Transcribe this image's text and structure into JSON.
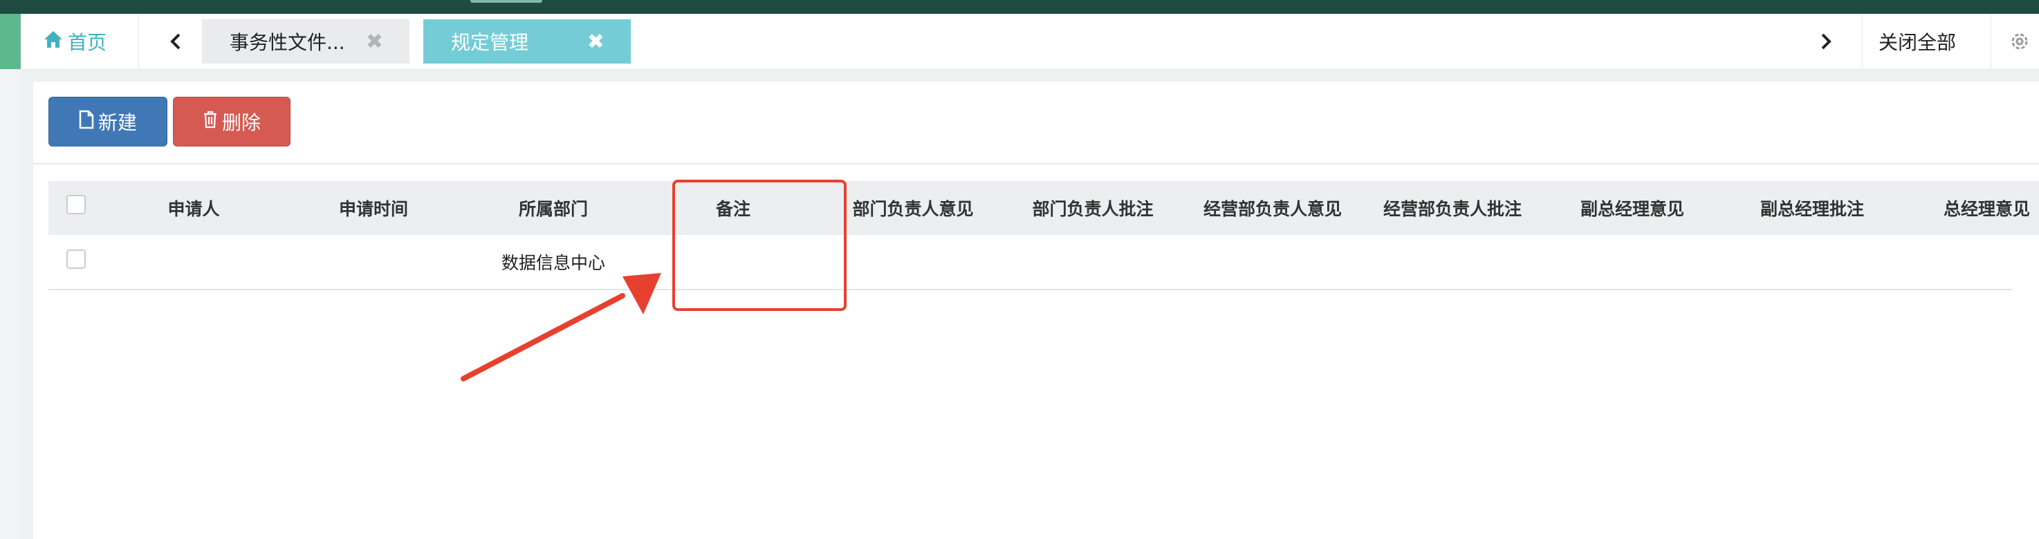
{
  "tabs": {
    "home_label": "首页",
    "tab1_label": "事务性文件...",
    "tab2_label": "规定管理",
    "close_glyph": "✖",
    "close_all_label": "关闭全部"
  },
  "toolbar": {
    "new_label": "新建",
    "delete_label": "删除"
  },
  "table": {
    "columns": [
      "申请人",
      "申请时间",
      "所属部门",
      "备注",
      "部门负责人意见",
      "部门负责人批注",
      "经营部负责人意见",
      "经营部负责人批注",
      "副总经理意见",
      "副总经理批注",
      "总经理意见"
    ],
    "rows": [
      {
        "applicant": "",
        "time": "",
        "department": "数据信息中心",
        "remark": ""
      }
    ]
  },
  "colors": {
    "accent": "#74ccd6",
    "primary": "#3f78b5",
    "danger": "#d55a52",
    "annotation": "#e7402f"
  },
  "icons": [
    "home-icon",
    "chevron-left-icon",
    "chevron-right-icon",
    "gear-icon",
    "file-icon",
    "trash-icon"
  ]
}
